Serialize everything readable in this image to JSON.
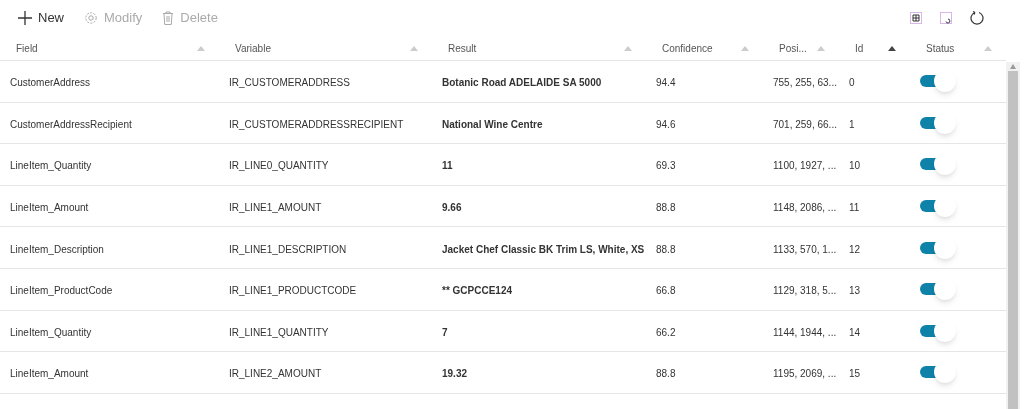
{
  "toolbar": [
    {
      "kind": "new",
      "label": "New",
      "disabled": false
    },
    {
      "kind": "modify",
      "label": "Modify",
      "disabled": true
    },
    {
      "kind": "delete",
      "label": "Delete",
      "disabled": true
    }
  ],
  "view_tools": [
    {
      "kind": "grid"
    },
    {
      "kind": "export"
    },
    {
      "kind": "refresh"
    }
  ],
  "table": {
    "columns": [
      {
        "label": "Field",
        "sorted": false
      },
      {
        "label": "Variable",
        "sorted": false
      },
      {
        "label": "Result",
        "sorted": false
      },
      {
        "label": "Confidence",
        "sorted": false
      },
      {
        "label": "Posi...",
        "sorted": false
      },
      {
        "label": "Id",
        "sorted": true
      },
      {
        "label": "Status",
        "sorted": false
      }
    ],
    "rows": [
      {
        "field": "CustomerAddress",
        "variable": "IR_CUSTOMERADDRESS",
        "result": "Botanic Road ADELAIDE SA 5000",
        "confidence": "94.4",
        "position": "755, 255, 63...",
        "id": "0",
        "on": true
      },
      {
        "field": "CustomerAddressRecipient",
        "variable": "IR_CUSTOMERADDRESSRECIPIENT",
        "result": "National Wine Centre",
        "confidence": "94.6",
        "position": "701, 259, 66...",
        "id": "1",
        "on": true
      },
      {
        "field": "LineItem_Quantity",
        "variable": "IR_LINE0_QUANTITY",
        "result": "11",
        "confidence": "69.3",
        "position": "1100, 1927, ...",
        "id": "10",
        "on": true
      },
      {
        "field": "LineItem_Amount",
        "variable": "IR_LINE1_AMOUNT",
        "result": "9.66",
        "confidence": "88.8",
        "position": "1148, 2086, ...",
        "id": "11",
        "on": true
      },
      {
        "field": "LineItem_Description",
        "variable": "IR_LINE1_DESCRIPTION",
        "result": "Jacket Chef Classic BK Trim LS, White, XS",
        "confidence": "88.8",
        "position": "1133, 570, 1...",
        "id": "12",
        "on": true
      },
      {
        "field": "LineItem_ProductCode",
        "variable": "IR_LINE1_PRODUCTCODE",
        "result": "** GCPCCE124",
        "confidence": "66.8",
        "position": "1129, 318, 5...",
        "id": "13",
        "on": true
      },
      {
        "field": "LineItem_Quantity",
        "variable": "IR_LINE1_QUANTITY",
        "result": "7",
        "confidence": "66.2",
        "position": "1144, 1944, ...",
        "id": "14",
        "on": true
      },
      {
        "field": "LineItem_Amount",
        "variable": "IR_LINE2_AMOUNT",
        "result": "19.32",
        "confidence": "88.8",
        "position": "1195, 2069, ...",
        "id": "15",
        "on": true
      }
    ]
  }
}
